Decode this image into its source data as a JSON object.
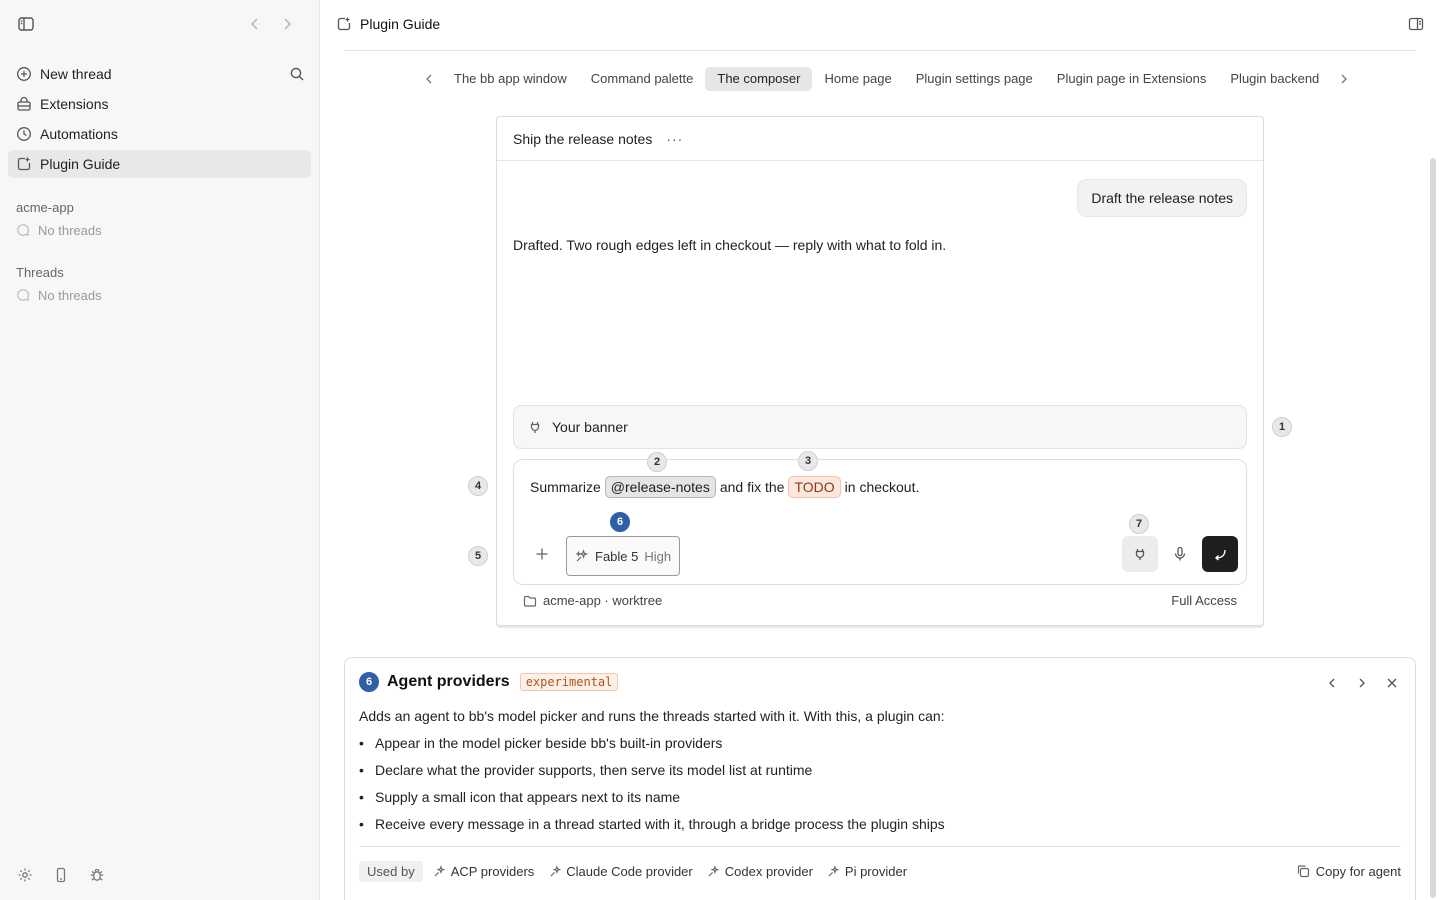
{
  "sidebar": {
    "items": [
      {
        "label": "New thread",
        "icon": "plus-circle-icon"
      },
      {
        "label": "Extensions",
        "icon": "extensions-icon"
      },
      {
        "label": "Automations",
        "icon": "clock-icon"
      },
      {
        "label": "Plugin Guide",
        "icon": "plugin-guide-icon"
      }
    ],
    "project": "acme-app",
    "project_empty": "No threads",
    "threads_header": "Threads",
    "threads_empty": "No threads"
  },
  "header": {
    "title": "Plugin Guide"
  },
  "tabs": [
    {
      "label": "The bb app window"
    },
    {
      "label": "Command palette"
    },
    {
      "label": "The composer",
      "active": true
    },
    {
      "label": "Home page"
    },
    {
      "label": "Plugin settings page"
    },
    {
      "label": "Plugin page in Extensions"
    },
    {
      "label": "Plugin backend"
    }
  ],
  "composer": {
    "thread_title": "Ship the release notes",
    "more": "···",
    "user_message": "Draft the release notes",
    "assistant_message": "Drafted. Two rough edges left in checkout — reply with what to fold in.",
    "banner": "Your banner",
    "prompt": {
      "pre": "Summarize",
      "mention": "@release-notes",
      "mid": "and fix the",
      "todo": "TODO",
      "post": "in checkout."
    },
    "model": {
      "name": "Fable 5",
      "level": "High"
    },
    "workspace": "acme-app · worktree",
    "access": "Full Access"
  },
  "markers": {
    "m1": "1",
    "m2": "2",
    "m3": "3",
    "m4": "4",
    "m5": "5",
    "m6": "6",
    "m7": "7"
  },
  "panel": {
    "number": "6",
    "title": "Agent providers",
    "tag": "experimental",
    "description": "Adds an agent to bb's model picker and runs the threads started with it. With this, a plugin can:",
    "bullets": [
      "Appear in the model picker beside bb's built-in providers",
      "Declare what the provider supports, then serve its model list at runtime",
      "Supply a small icon that appears next to its name",
      "Receive every message in a thread started with it, through a bridge process the plugin ships"
    ],
    "used_by_label": "Used by",
    "used_by": [
      "ACP providers",
      "Claude Code provider",
      "Codex provider",
      "Pi provider"
    ],
    "copy_label": "Copy for agent"
  },
  "colors": {
    "accent_blue": "#2f5fa8",
    "todo_bg": "#fde6dc",
    "tag_text": "#b25418",
    "send_bg": "#1f1f1f"
  }
}
